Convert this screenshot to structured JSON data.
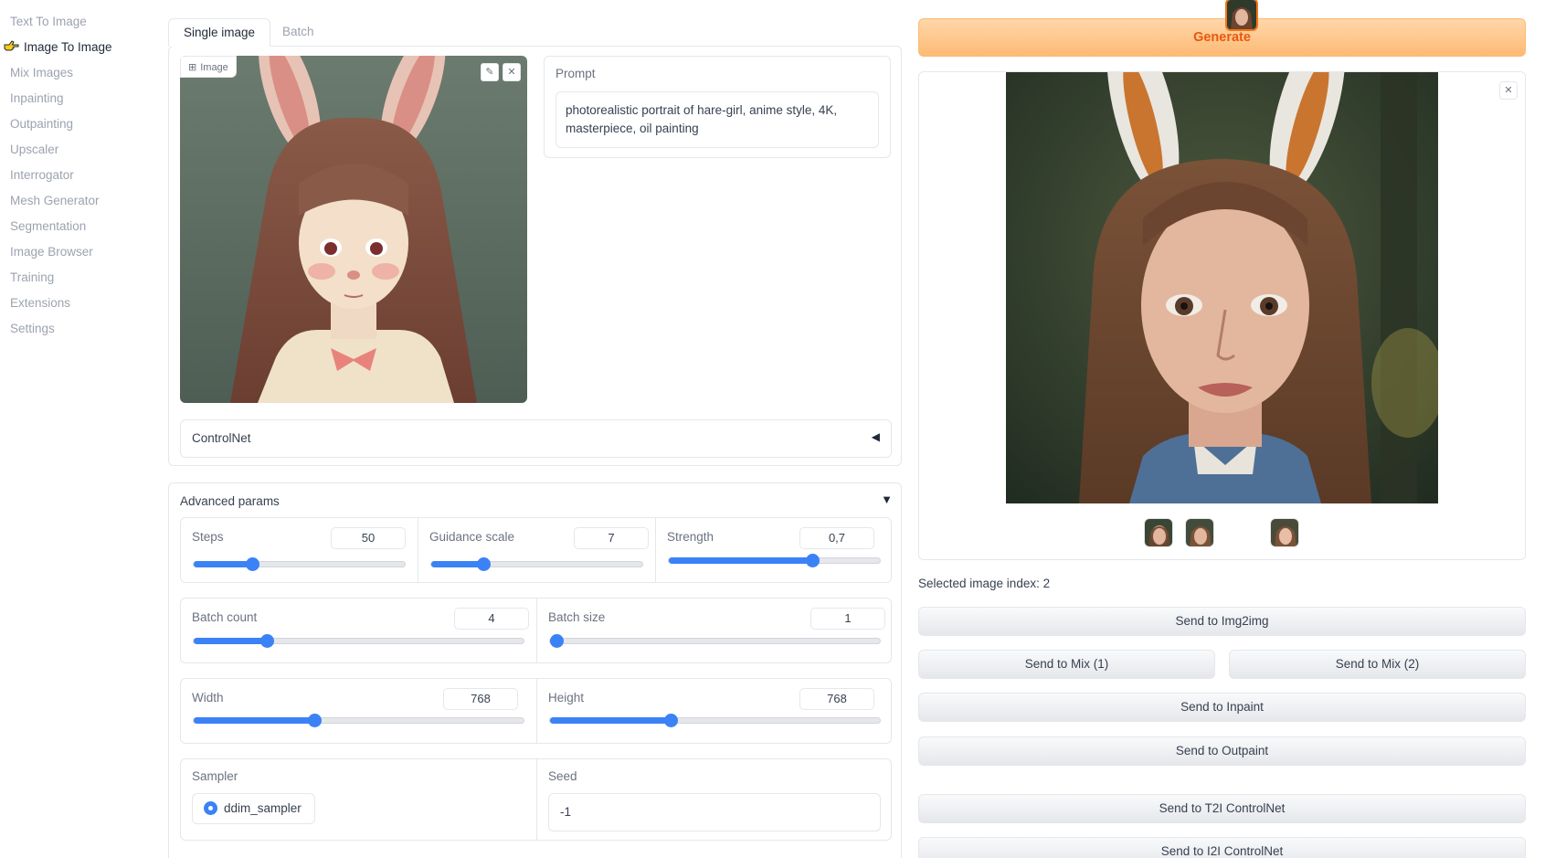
{
  "sidebar": {
    "items": [
      {
        "label": "Text To Image",
        "active": false
      },
      {
        "label": "Image To Image",
        "active": true
      },
      {
        "label": "Mix Images",
        "active": false
      },
      {
        "label": "Inpainting",
        "active": false
      },
      {
        "label": "Outpainting",
        "active": false
      },
      {
        "label": "Upscaler",
        "active": false
      },
      {
        "label": "Interrogator",
        "active": false
      },
      {
        "label": "Mesh Generator",
        "active": false
      },
      {
        "label": "Segmentation",
        "active": false
      },
      {
        "label": "Image Browser",
        "active": false
      },
      {
        "label": "Training",
        "active": false
      },
      {
        "label": "Extensions",
        "active": false
      },
      {
        "label": "Settings",
        "active": false
      }
    ]
  },
  "tabs": [
    {
      "label": "Single image",
      "active": true
    },
    {
      "label": "Batch",
      "active": false
    }
  ],
  "input_image": {
    "tag": "Image",
    "icon": "image-icon"
  },
  "prompt": {
    "label": "Prompt",
    "value": "photorealistic portrait of hare-girl, anime style, 4K, masterpiece, oil painting"
  },
  "controlnet": {
    "label": "ControlNet",
    "icon": "triangle-left-icon"
  },
  "advanced": {
    "label": "Advanced params",
    "icon": "triangle-down-icon",
    "steps": {
      "label": "Steps",
      "value": "50",
      "level": 0.26
    },
    "guidance": {
      "label": "Guidance scale",
      "value": "7",
      "level": 0.23
    },
    "strength": {
      "label": "Strength",
      "value": "0,7",
      "level": 0.69
    },
    "batch_count": {
      "label": "Batch count",
      "value": "4",
      "level": 0.21
    },
    "batch_size": {
      "label": "Batch size",
      "value": "1",
      "level": 0.0
    },
    "width": {
      "label": "Width",
      "value": "768",
      "level": 0.36
    },
    "height": {
      "label": "Height",
      "value": "768",
      "level": 0.36
    },
    "sampler": {
      "label": "Sampler",
      "value": "ddim_sampler"
    },
    "seed": {
      "label": "Seed",
      "value": "-1"
    }
  },
  "generate": {
    "label": "Generate"
  },
  "gallery": {
    "close_icon": "close-icon",
    "thumbnail_count": 4,
    "selected_index": 2,
    "selected_text": "Selected image index: 2"
  },
  "actions": {
    "img2img": "Send to Img2img",
    "mix1": "Send to Mix (1)",
    "mix2": "Send to Mix (2)",
    "inpaint": "Send to Inpaint",
    "outpaint": "Send to Outpaint",
    "t2i_controlnet": "Send to T2I ControlNet",
    "i2i_controlnet": "Send to I2I ControlNet"
  },
  "colors": {
    "accent": "#3b82f6",
    "generate_text": "#ea580c",
    "selected_thumb": "#f97316"
  }
}
